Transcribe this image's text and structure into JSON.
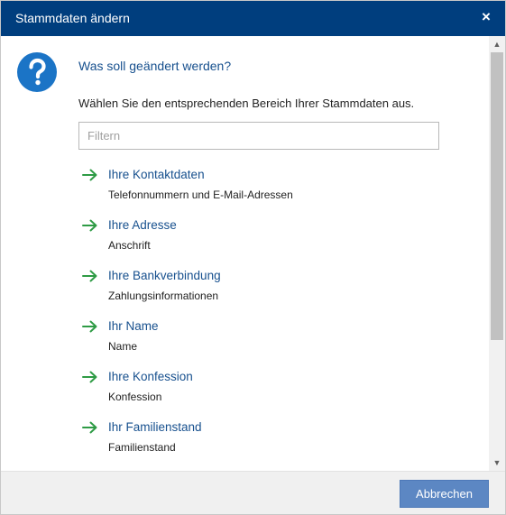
{
  "dialog": {
    "title": "Stammdaten ändern",
    "close_symbol": "×",
    "heading": "Was soll geändert werden?",
    "description": "Wählen Sie den entsprechenden Bereich Ihrer Stammdaten aus.",
    "filter": {
      "placeholder": "Filtern",
      "value": ""
    },
    "options": [
      {
        "title": "Ihre Kontaktdaten",
        "subtitle": "Telefonnummern und E-Mail-Adressen"
      },
      {
        "title": "Ihre Adresse",
        "subtitle": "Anschrift"
      },
      {
        "title": "Ihre Bankverbindung",
        "subtitle": "Zahlungsinformationen"
      },
      {
        "title": "Ihr Name",
        "subtitle": "Name"
      },
      {
        "title": "Ihre Konfession",
        "subtitle": "Konfession"
      },
      {
        "title": "Ihr Familienstand",
        "subtitle": "Familienstand"
      }
    ],
    "cancel_label": "Abbrechen"
  },
  "icons": {
    "question": "question-circle-icon",
    "arrow": "arrow-right-icon",
    "close": "close-icon"
  },
  "colors": {
    "titlebar": "#003e7e",
    "link": "#17508e",
    "arrow": "#2e9b45",
    "icon": "#1b74c6",
    "button": "#5c87c3"
  }
}
